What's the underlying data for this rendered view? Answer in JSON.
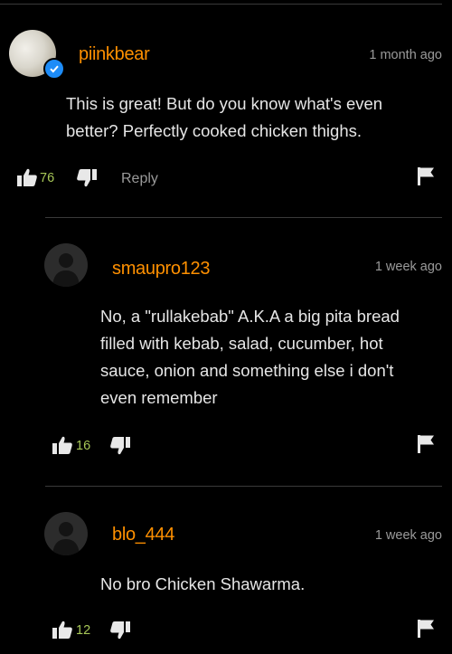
{
  "comments": [
    {
      "username": "piinkbear",
      "time": "1 month ago",
      "text": "This is great! But do you know what's even better? Perfectly cooked chicken thighs.",
      "likes": "76",
      "reply_label": "Reply"
    },
    {
      "username": "smaupro123",
      "time": "1 week ago",
      "text": "No, a \"rullakebab\" A.K.A a big pita bread filled with kebab, salad, cucumber, hot sauce, onion and something else i don't even remember",
      "likes": "16"
    },
    {
      "username": "blo_444",
      "time": "1 week ago",
      "text": "No bro Chicken Shawarma.",
      "likes": "12"
    }
  ],
  "colors": {
    "background": "#000000",
    "username": "#ff9000",
    "like_count": "#a7c757",
    "verified_badge": "#1d8cf8"
  },
  "icons": [
    "verified-icon",
    "thumbs-up-icon",
    "thumbs-down-icon",
    "flag-icon",
    "default-avatar-icon"
  ]
}
